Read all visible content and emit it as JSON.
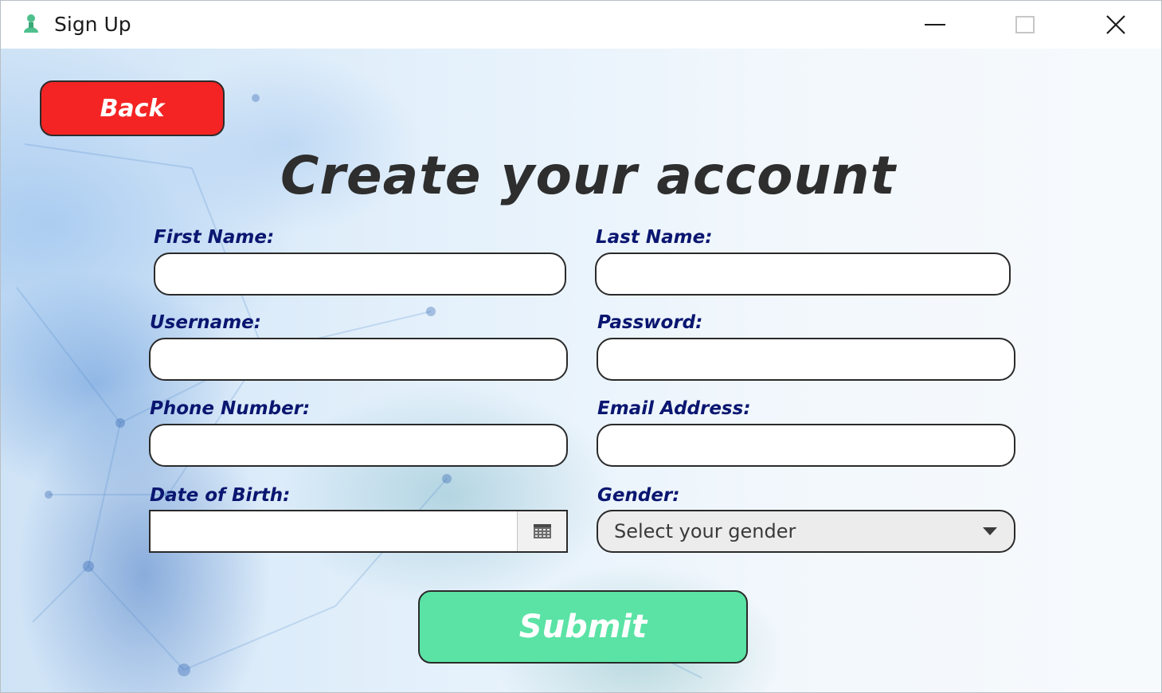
{
  "window": {
    "title": "Sign Up",
    "app_icon": "person-icon",
    "controls": {
      "minimize_icon": "minimize-icon",
      "maximize_icon": "maximize-icon",
      "close_icon": "close-icon"
    }
  },
  "colors": {
    "back_button": "#f42424",
    "submit_button": "#5ae3a5",
    "label_text": "#0a1670",
    "title_text": "#2e2e2e"
  },
  "form": {
    "back_label": "Back",
    "title": "Create your account",
    "fields": {
      "first_name": {
        "label": "First Name:",
        "value": ""
      },
      "last_name": {
        "label": "Last Name:",
        "value": ""
      },
      "username": {
        "label": "Username:",
        "value": ""
      },
      "password": {
        "label": "Password:",
        "value": ""
      },
      "phone_number": {
        "label": "Phone Number:",
        "value": ""
      },
      "email_address": {
        "label": "Email Address:",
        "value": ""
      },
      "date_of_birth": {
        "label": "Date of Birth:",
        "value": "",
        "button_icon": "calendar-icon"
      },
      "gender": {
        "label": "Gender:",
        "placeholder": "Select your gender",
        "arrow_icon": "chevron-down-icon"
      }
    },
    "submit_label": "Submit"
  }
}
